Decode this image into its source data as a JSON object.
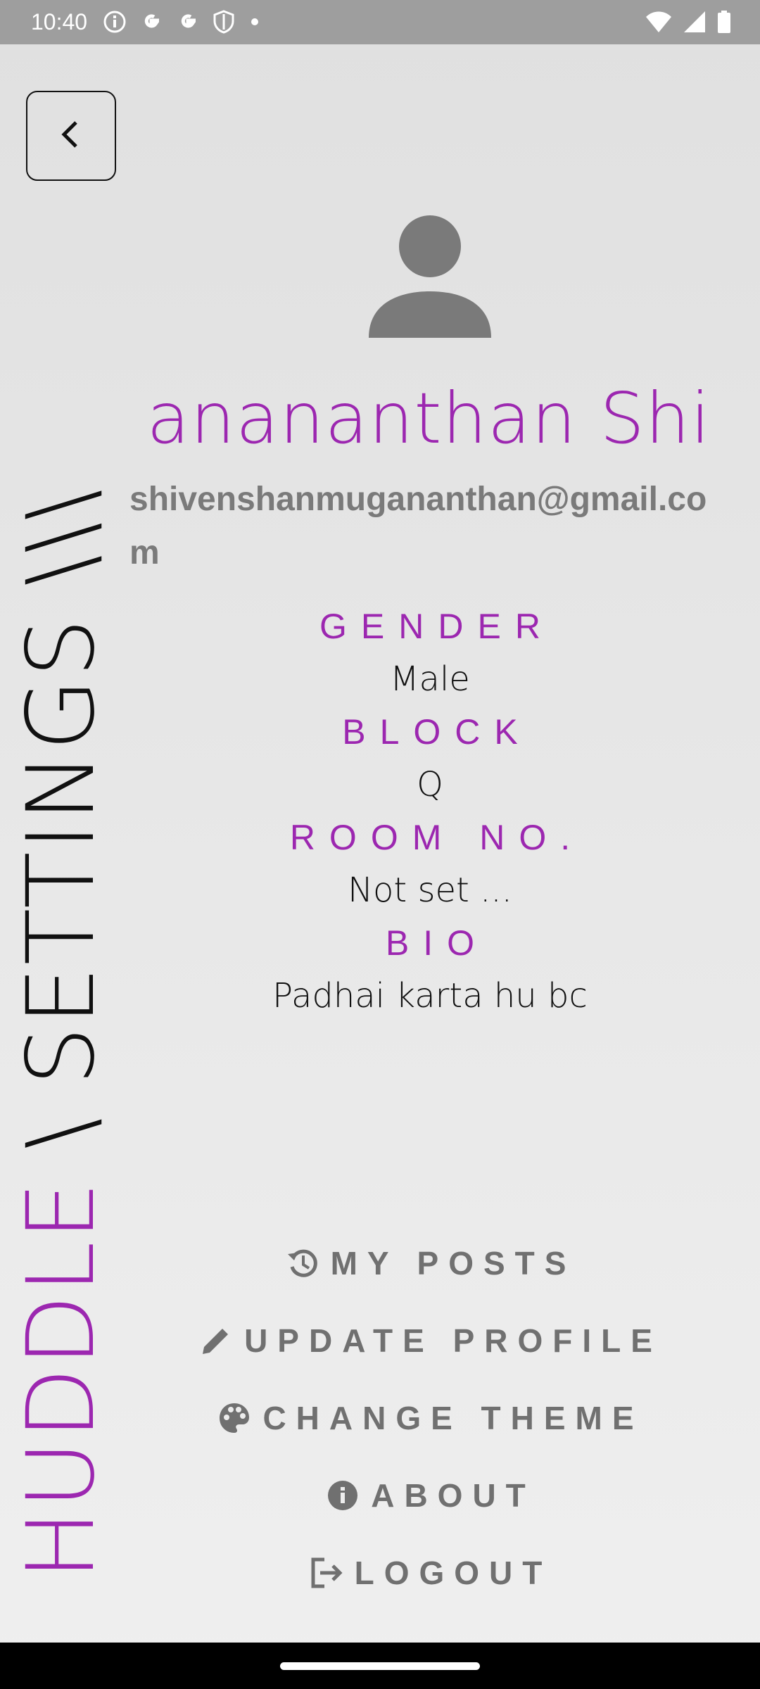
{
  "status_bar": {
    "time": "10:40",
    "left_icons": [
      "info-icon",
      "google-icon",
      "google-icon",
      "shield-icon",
      "dot-icon"
    ],
    "right_icons": [
      "wifi-icon",
      "signal-icon",
      "battery-icon"
    ]
  },
  "back_button": {
    "icon": "chevron-left-icon"
  },
  "side_title": {
    "brand": "HUDDLE",
    "suffix": " \\ SETTINGS \\\\\\"
  },
  "profile": {
    "avatar_icon": "person-icon",
    "name": "muganananthan  Shi",
    "email": "shivenshanmugananthan@gmail.com"
  },
  "fields": [
    {
      "label": "GENDER",
      "value": "Male"
    },
    {
      "label": "BLOCK",
      "value": "Q"
    },
    {
      "label": "ROOM NO.",
      "value": "Not set ..."
    },
    {
      "label": "BIO",
      "value": "Padhai karta hu bc"
    }
  ],
  "menu": [
    {
      "label": "MY POSTS",
      "icon": "history-icon"
    },
    {
      "label": "UPDATE PROFILE",
      "icon": "pencil-icon"
    },
    {
      "label": "CHANGE THEME",
      "icon": "palette-icon"
    },
    {
      "label": "ABOUT",
      "icon": "info-icon"
    },
    {
      "label": "LOGOUT",
      "icon": "logout-icon"
    }
  ],
  "colors": {
    "accent": "#9c27b0",
    "menu_text": "#707070",
    "status_bar": "#9e9e9e"
  }
}
